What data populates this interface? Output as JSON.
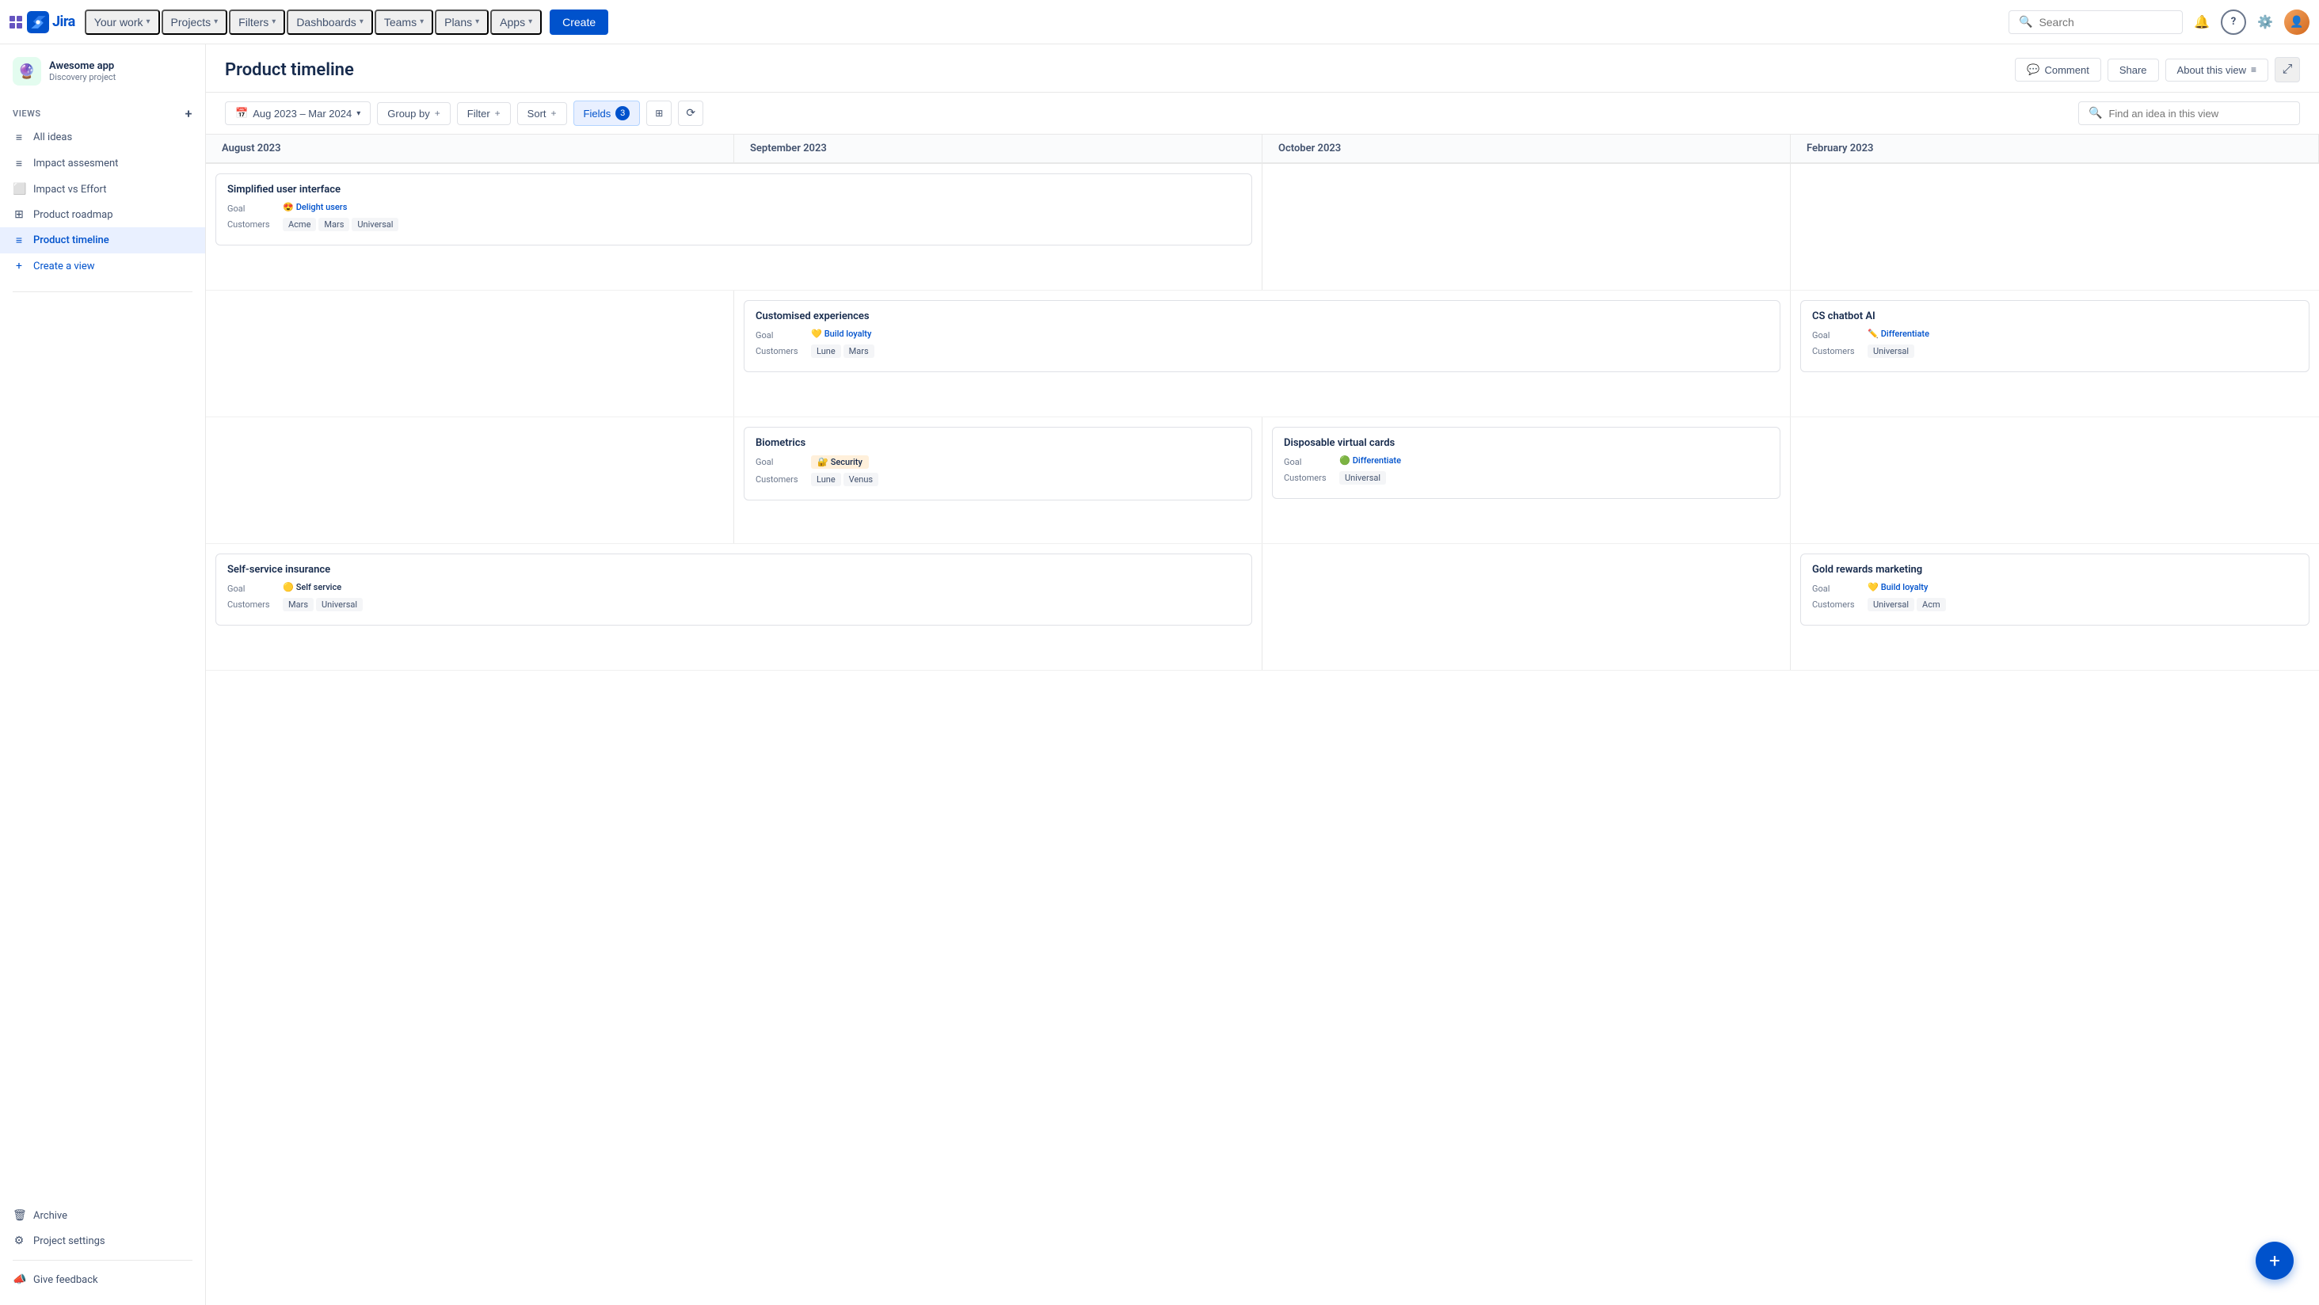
{
  "nav": {
    "logo_alt": "Jira",
    "items": [
      {
        "label": "Your work",
        "has_dropdown": true
      },
      {
        "label": "Projects",
        "has_dropdown": true
      },
      {
        "label": "Filters",
        "has_dropdown": true
      },
      {
        "label": "Dashboards",
        "has_dropdown": true
      },
      {
        "label": "Teams",
        "has_dropdown": true
      },
      {
        "label": "Plans",
        "has_dropdown": true
      },
      {
        "label": "Apps",
        "has_dropdown": true
      }
    ],
    "create_label": "Create",
    "search_placeholder": "Search",
    "notification_icon": "🔔",
    "help_icon": "?",
    "settings_icon": "⚙"
  },
  "sidebar": {
    "project_name": "Awesome app",
    "project_sub": "Discovery project",
    "views_label": "VIEWS",
    "add_view_icon": "+",
    "views": [
      {
        "label": "All ideas",
        "icon": "≡"
      },
      {
        "label": "Impact assesment",
        "icon": "≡"
      },
      {
        "label": "Impact vs Effort",
        "icon": "⬜"
      },
      {
        "label": "Product roadmap",
        "icon": "⊞"
      },
      {
        "label": "Product timeline",
        "icon": "≡",
        "active": true
      }
    ],
    "create_view_label": "Create a view",
    "archive_label": "Archive",
    "project_settings_label": "Project settings",
    "give_feedback_label": "Give feedback"
  },
  "page": {
    "title": "Product timeline",
    "comment_btn": "Comment",
    "share_btn": "Share",
    "about_btn": "About this view"
  },
  "toolbar": {
    "date_range": "Aug 2023 – Mar 2024",
    "group_by": "Group by",
    "filter": "Filter",
    "sort": "Sort",
    "fields": "Fields",
    "fields_count": "3",
    "search_placeholder": "Find an idea in this view"
  },
  "timeline": {
    "columns": [
      {
        "label": "August 2023"
      },
      {
        "label": "September 2023"
      },
      {
        "label": "October 2023"
      },
      {
        "label": "February 2023"
      }
    ],
    "row1": {
      "card": {
        "col_start": 1,
        "col_span": 2,
        "title": "Simplified user interface",
        "goal_emoji": "😍",
        "goal": "Delight users",
        "customers": [
          "Acme",
          "Mars",
          "Universal"
        ]
      }
    },
    "row2": {
      "card1": {
        "col_start": 2,
        "col_span": 3,
        "title": "Customised experiences",
        "goal_emoji": "💛",
        "goal": "Build loyalty",
        "customers": [
          "Lune",
          "Mars"
        ]
      },
      "card2": {
        "col_start": 4,
        "title": "CS chatbot AI",
        "goal_emoji": "✏️",
        "goal": "Differentiate",
        "customers": [
          "Universal"
        ]
      }
    },
    "row3": {
      "card1": {
        "col_start": 2,
        "title": "Biometrics",
        "goal_emoji": "🔐",
        "goal": "Security",
        "customers": [
          "Lune",
          "Venus"
        ]
      },
      "card2": {
        "col_start": 3,
        "title": "Disposable virtual cards",
        "goal_emoji": "🟢",
        "goal": "Differentiate",
        "customers": [
          "Universal"
        ]
      }
    },
    "row4": {
      "card1": {
        "col_start": 1,
        "col_span": 2,
        "title": "Self-service insurance",
        "goal_emoji": "🟡",
        "goal": "Self service",
        "customers": [
          "Mars",
          "Universal"
        ]
      },
      "card2": {
        "col_start": 4,
        "title": "Gold rewards marketing",
        "goal_emoji": "💛",
        "goal": "Build loyalty",
        "customers": [
          "Universal",
          "Acm"
        ]
      }
    }
  },
  "fab": {
    "label": "+"
  }
}
